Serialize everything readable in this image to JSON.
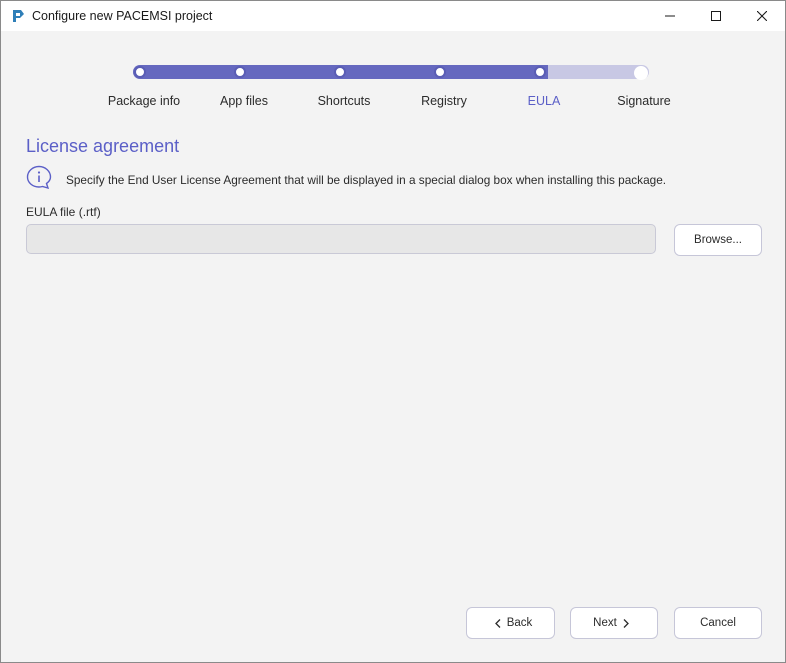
{
  "window": {
    "title": "Configure new PACEMSI project"
  },
  "stepper": {
    "steps": [
      {
        "label": "Package info"
      },
      {
        "label": "App files"
      },
      {
        "label": "Shortcuts"
      },
      {
        "label": "Registry"
      },
      {
        "label": "EULA"
      },
      {
        "label": "Signature"
      }
    ],
    "current_step": 5,
    "total_steps": 6
  },
  "content": {
    "title": "License agreement",
    "info_text": "Specify the End User License Agreement that will be displayed in a special dialog box when installing this package.",
    "eula_label": "EULA file (.rtf)",
    "eula_value": "",
    "browse_label": "Browse..."
  },
  "footer": {
    "back_label": "Back",
    "next_label": "Next",
    "cancel_label": "Cancel"
  },
  "colors": {
    "accent": "#5b5fc7",
    "track_done": "#6568bf",
    "track_pending": "#c8c8e4",
    "background": "#f3f3f3"
  },
  "icons": [
    "app-logo-icon",
    "minimize-icon",
    "maximize-icon",
    "close-icon",
    "info-icon",
    "chevron-left-icon",
    "chevron-right-icon"
  ]
}
